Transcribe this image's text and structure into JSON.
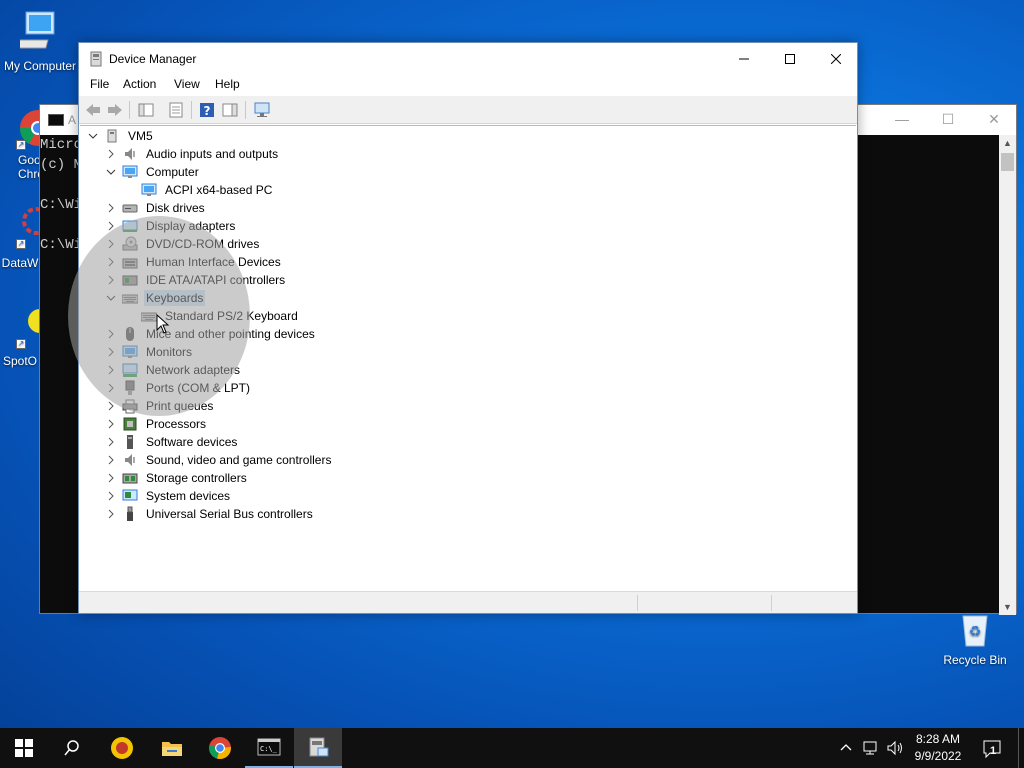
{
  "desktop": {
    "icons": [
      {
        "label": "My Computer"
      },
      {
        "label": "Goo\nChro"
      },
      {
        "label": "DataW"
      },
      {
        "label": "SpotO"
      },
      {
        "label": "Recycle Bin"
      }
    ]
  },
  "console": {
    "title": "A",
    "lines": [
      "Micro",
      "(c) M",
      "",
      "C:\\Wi",
      "",
      "C:\\Wi"
    ]
  },
  "device_manager": {
    "title": "Device Manager",
    "menu": [
      "File",
      "Action",
      "View",
      "Help"
    ],
    "root": "VM5",
    "tree": [
      {
        "label": "Audio inputs and outputs",
        "icon": "speaker-icon",
        "state": "collapsed",
        "level": 1
      },
      {
        "label": "Computer",
        "icon": "monitor-icon",
        "state": "expanded",
        "level": 1
      },
      {
        "label": "ACPI x64-based PC",
        "icon": "monitor-icon",
        "state": "leaf",
        "level": 2
      },
      {
        "label": "Disk drives",
        "icon": "disk-drive-icon",
        "state": "collapsed",
        "level": 1
      },
      {
        "label": "Display adapters",
        "icon": "display-adapter-icon",
        "state": "collapsed",
        "level": 1
      },
      {
        "label": "DVD/CD-ROM drives",
        "icon": "dvd-icon",
        "state": "collapsed",
        "level": 1
      },
      {
        "label": "Human Interface Devices",
        "icon": "hid-icon",
        "state": "collapsed",
        "level": 1
      },
      {
        "label": "IDE ATA/ATAPI controllers",
        "icon": "ide-icon",
        "state": "collapsed",
        "level": 1
      },
      {
        "label": "Keyboards",
        "icon": "keyboard-icon",
        "state": "expanded",
        "level": 1,
        "selected": true
      },
      {
        "label": "Standard PS/2 Keyboard",
        "icon": "keyboard-icon",
        "state": "leaf",
        "level": 2
      },
      {
        "label": "Mice and other pointing devices",
        "icon": "mouse-icon",
        "state": "collapsed",
        "level": 1
      },
      {
        "label": "Monitors",
        "icon": "monitor-icon",
        "state": "collapsed",
        "level": 1
      },
      {
        "label": "Network adapters",
        "icon": "network-icon",
        "state": "collapsed",
        "level": 1
      },
      {
        "label": "Ports (COM & LPT)",
        "icon": "port-icon",
        "state": "collapsed",
        "level": 1
      },
      {
        "label": "Print queues",
        "icon": "printer-icon",
        "state": "collapsed",
        "level": 1
      },
      {
        "label": "Processors",
        "icon": "processor-icon",
        "state": "collapsed",
        "level": 1
      },
      {
        "label": "Software devices",
        "icon": "software-device-icon",
        "state": "collapsed",
        "level": 1
      },
      {
        "label": "Sound, video and game controllers",
        "icon": "speaker-icon",
        "state": "collapsed",
        "level": 1
      },
      {
        "label": "Storage controllers",
        "icon": "storage-icon",
        "state": "collapsed",
        "level": 1
      },
      {
        "label": "System devices",
        "icon": "system-icon",
        "state": "collapsed",
        "level": 1
      },
      {
        "label": "Universal Serial Bus controllers",
        "icon": "usb-icon",
        "state": "collapsed",
        "level": 1
      }
    ]
  },
  "taskbar": {
    "time": "8:28 AM",
    "date": "9/9/2022",
    "notification_count": "1"
  }
}
